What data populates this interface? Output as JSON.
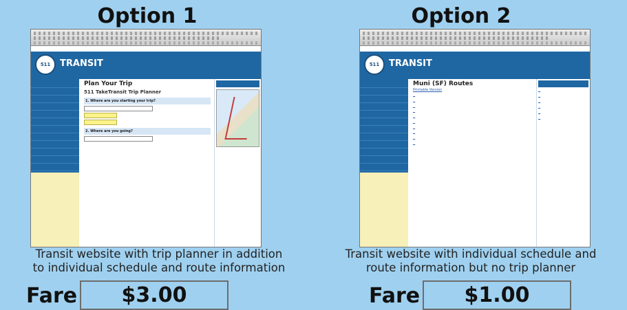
{
  "options": [
    {
      "title": "Option 1",
      "caption_line1": "Transit website with trip planner in addition",
      "caption_line2": "to individual schedule and route information",
      "fare_label": "Fare",
      "fare_value": "$3.00",
      "screenshot": {
        "site_name": "TRANSIT",
        "logo_text": "511",
        "page_heading": "Plan Your Trip",
        "sub_heading": "511 TakeTransit Trip Planner",
        "step1": "1. Where are you starting your trip?",
        "step2": "2. Where are you going?"
      }
    },
    {
      "title": "Option 2",
      "caption_line1": "Transit website with individual schedule and",
      "caption_line2": "route information but no trip planner",
      "fare_label": "Fare",
      "fare_value": "$1.00",
      "screenshot": {
        "site_name": "TRANSIT",
        "logo_text": "511",
        "page_heading": "Muni (SF) Routes",
        "link_text": "Printable Version"
      }
    }
  ]
}
